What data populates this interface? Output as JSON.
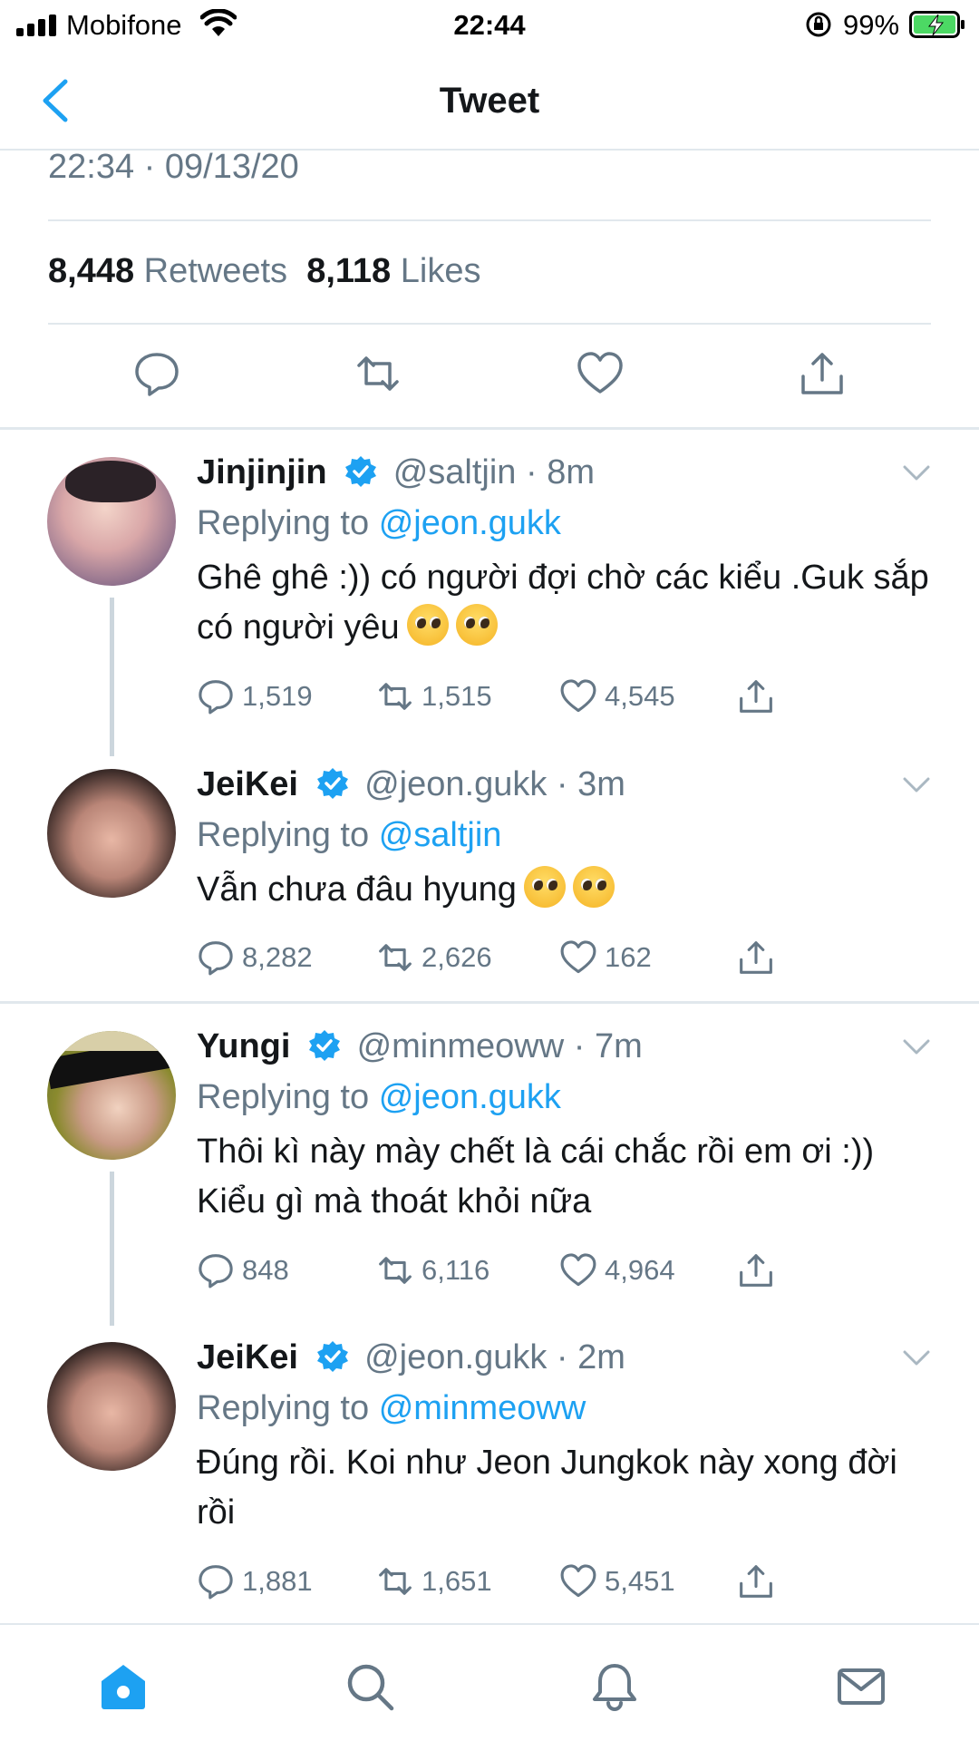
{
  "status_bar": {
    "carrier": "Mobifone",
    "time": "22:44",
    "battery": "99%"
  },
  "nav": {
    "title": "Tweet"
  },
  "tweet": {
    "timestamp": "22:34 · 09/13/20",
    "retweets_count": "8,448",
    "retweets_label": "Retweets",
    "likes_count": "8,118",
    "likes_label": "Likes"
  },
  "replies": [
    {
      "name": "Jinjinjin",
      "handle": "@saltjin",
      "time": "· 8m",
      "replying_label": "Replying to",
      "replying_to": "@jeon.gukk",
      "text": "Ghê ghê :)) có người đợi chờ các kiểu .Guk sắp có người yêu",
      "replies": "1,519",
      "retweets": "1,515",
      "likes": "4,545"
    },
    {
      "name": "JeiKei",
      "handle": "@jeon.gukk",
      "time": "· 3m",
      "replying_label": "Replying to",
      "replying_to": "@saltjin",
      "text": "Vẫn chưa đâu hyung",
      "replies": "8,282",
      "retweets": "2,626",
      "likes": "162"
    },
    {
      "name": "Yungi",
      "handle": "@minmeoww",
      "time": "· 7m",
      "replying_label": "Replying to",
      "replying_to": "@jeon.gukk",
      "text": "Thôi kì này mày chết là cái chắc rồi em ơi :)) Kiểu gì mà thoát khỏi nữa",
      "replies": "848",
      "retweets": "6,116",
      "likes": "4,964"
    },
    {
      "name": "JeiKei",
      "handle": "@jeon.gukk",
      "time": "· 2m",
      "replying_label": "Replying to",
      "replying_to": "@minmeoww",
      "text": "Đúng rồi. Koi như Jeon Jungkok này xong đời rồi",
      "replies": "1,881",
      "retweets": "1,651",
      "likes": "5,451"
    }
  ],
  "icons": {
    "back": "chevron-left-icon",
    "reply": "speech-bubble-icon",
    "retweet": "retweet-icon",
    "like": "heart-icon",
    "share": "share-icon",
    "verified": "verified-badge-icon",
    "more": "chevron-down-icon",
    "home": "home-icon",
    "search": "search-icon",
    "notifications": "bell-icon",
    "messages": "envelope-icon"
  },
  "colors": {
    "accent": "#1da1f2",
    "secondary_text": "#657786",
    "divider": "#e1e8ed",
    "battery": "#4cd964"
  }
}
